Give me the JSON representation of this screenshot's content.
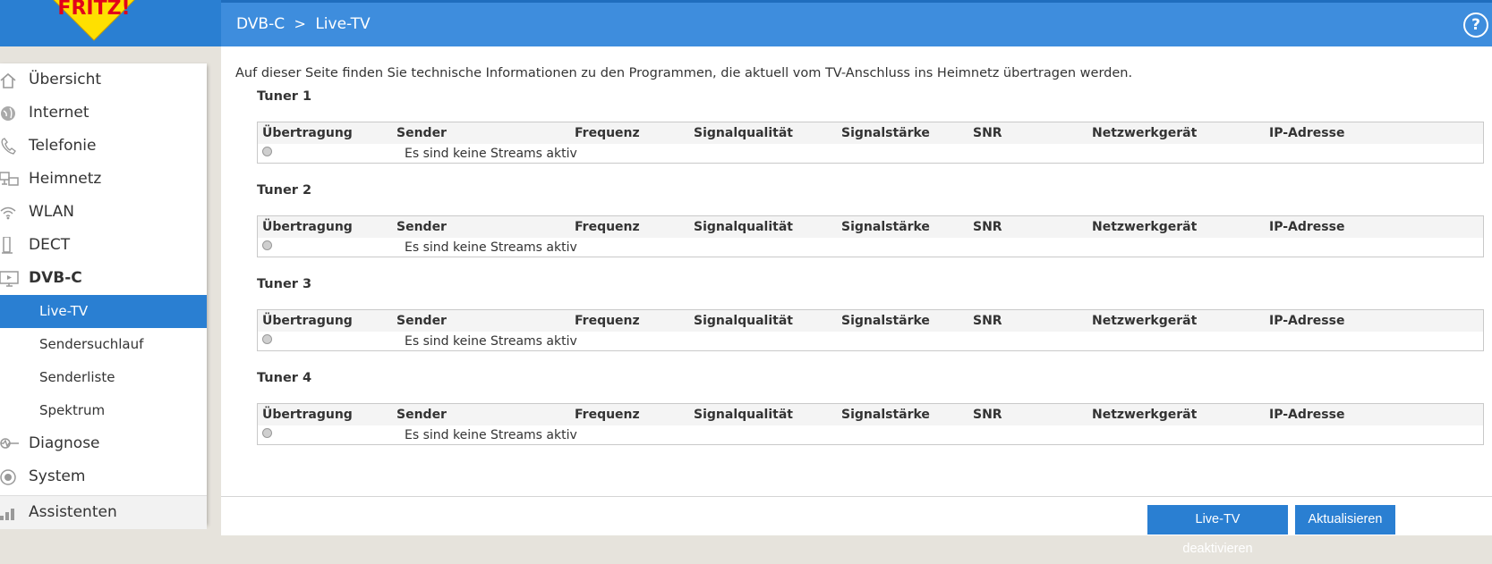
{
  "header": {
    "breadcrumb_parent": "DVB-C",
    "breadcrumb_sep": ">",
    "breadcrumb_current": "Live-TV",
    "help_label": "?"
  },
  "sidebar": {
    "items": [
      {
        "label": "Übersicht",
        "icon": "home-icon"
      },
      {
        "label": "Internet",
        "icon": "globe-icon"
      },
      {
        "label": "Telefonie",
        "icon": "phone-icon"
      },
      {
        "label": "Heimnetz",
        "icon": "network-icon"
      },
      {
        "label": "WLAN",
        "icon": "wifi-icon"
      },
      {
        "label": "DECT",
        "icon": "dect-icon"
      },
      {
        "label": "DVB-C",
        "icon": "tv-icon"
      }
    ],
    "sub_items": [
      {
        "label": "Live-TV"
      },
      {
        "label": "Sendersuchlauf"
      },
      {
        "label": "Senderliste"
      },
      {
        "label": "Spektrum"
      }
    ],
    "items_bottom": [
      {
        "label": "Diagnose",
        "icon": "diagnose-icon"
      },
      {
        "label": "System",
        "icon": "system-icon"
      }
    ],
    "assist": {
      "label": "Assistenten",
      "icon": "assistant-icon"
    }
  },
  "main": {
    "intro": "Auf dieser Seite finden Sie technische Informationen zu den Programmen, die aktuell vom TV-Anschluss ins Heimnetz übertragen werden.",
    "columns": [
      "Übertragung",
      "Sender",
      "Frequenz",
      "Signalqualität",
      "Signalstärke",
      "SNR",
      "Netzwerkgerät",
      "IP-Adresse"
    ],
    "tuners": [
      {
        "title": "Tuner 1",
        "message": "Es sind keine Streams aktiv"
      },
      {
        "title": "Tuner 2",
        "message": "Es sind keine Streams aktiv"
      },
      {
        "title": "Tuner 3",
        "message": "Es sind keine Streams aktiv"
      },
      {
        "title": "Tuner 4",
        "message": "Es sind keine Streams aktiv"
      }
    ]
  },
  "buttons": {
    "deactivate": "Live-TV deaktivieren",
    "refresh": "Aktualisieren"
  },
  "colors": {
    "accent": "#2a7fd2",
    "topbar": "#3e8ddd"
  }
}
